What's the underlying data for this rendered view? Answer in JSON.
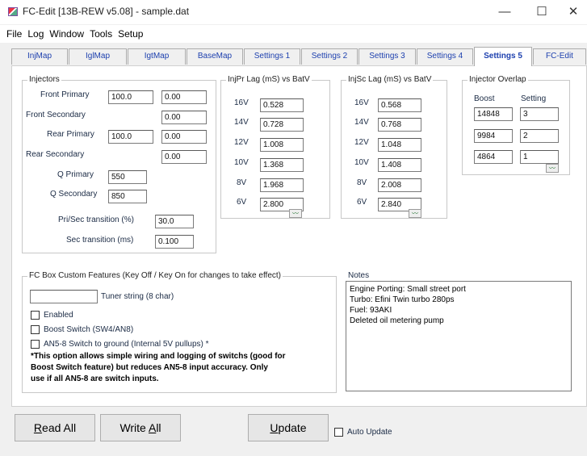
{
  "window": {
    "title": "FC-Edit [13B-REW v5.08] - sample.dat",
    "minimize": "—",
    "maximize": "☐",
    "close": "✕"
  },
  "menu": [
    "File",
    "Log",
    "Window",
    "Tools",
    "Setup"
  ],
  "tabs": [
    "InjMap",
    "IglMap",
    "IgtMap",
    "BaseMap",
    "Settings 1",
    "Settings 2",
    "Settings 3",
    "Settings 4",
    "Settings 5",
    "FC-Edit"
  ],
  "active_tab": "Settings 5",
  "injectors": {
    "title": "Injectors",
    "front_primary": {
      "label": "Front Primary",
      "v1": "100.0",
      "v2": "0.00"
    },
    "front_secondary": {
      "label": "Front Secondary",
      "v2": "0.00"
    },
    "rear_primary": {
      "label": "Rear Primary",
      "v1": "100.0",
      "v2": "0.00"
    },
    "rear_secondary": {
      "label": "Rear Secondary",
      "v2": "0.00"
    },
    "q_primary": {
      "label": "Q Primary",
      "value": "550"
    },
    "q_secondary": {
      "label": "Q Secondary",
      "value": "850"
    },
    "prisec_transition": {
      "label": "Pri/Sec transition (%)",
      "value": "30.0"
    },
    "sec_transition": {
      "label": "Sec transition (ms)",
      "value": "0.100"
    }
  },
  "injpr_lag": {
    "title": "InjPr Lag (mS) vs BatV",
    "rows": [
      {
        "v": "16V",
        "val": "0.528"
      },
      {
        "v": "14V",
        "val": "0.728"
      },
      {
        "v": "12V",
        "val": "1.008"
      },
      {
        "v": "10V",
        "val": "1.368"
      },
      {
        "v": "8V",
        "val": "1.968"
      },
      {
        "v": "6V",
        "val": "2.800"
      }
    ]
  },
  "injsc_lag": {
    "title": "InjSc Lag (mS) vs BatV",
    "rows": [
      {
        "v": "16V",
        "val": "0.568"
      },
      {
        "v": "14V",
        "val": "0.768"
      },
      {
        "v": "12V",
        "val": "1.048"
      },
      {
        "v": "10V",
        "val": "1.408"
      },
      {
        "v": "8V",
        "val": "2.008"
      },
      {
        "v": "6V",
        "val": "2.840"
      }
    ]
  },
  "injector_overlap": {
    "title": "Injector Overlap",
    "col_boost": "Boost",
    "col_setting": "Setting",
    "rows": [
      {
        "boost": "14848",
        "setting": "3"
      },
      {
        "boost": "9984",
        "setting": "2"
      },
      {
        "boost": "4864",
        "setting": "1"
      }
    ]
  },
  "custom_features": {
    "title": "FC Box Custom Features (Key Off / Key On for changes to take effect)",
    "tuner_string_label": "Tuner string (8 char)",
    "tuner_string_value": "",
    "enabled": "Enabled",
    "boost_switch": "Boost Switch (SW4/AN8)",
    "an58": "AN5-8 Switch to ground (Internal 5V pullups) *",
    "note_line1": "*This option allows simple wiring and logging of switchs (good for",
    "note_line2": "Boost Switch feature) but reduces AN5-8 input accuracy. Only",
    "note_line3": "use if all AN5-8 are switch inputs."
  },
  "notes": {
    "title": "Notes",
    "lines": [
      "Engine Porting: Small street port",
      "Turbo: Efini Twin turbo 280ps",
      "Fuel: 93AKI",
      "Deleted oil metering pump"
    ]
  },
  "buttons": {
    "read_all_pre": "R",
    "read_all_post": "ead All",
    "write_all_pre": "Write ",
    "write_all_u": "A",
    "write_all_post": "ll",
    "update_pre": "",
    "update_u": "U",
    "update_post": "pdate",
    "auto_update": "Auto Update"
  },
  "wave_glyph": "〰"
}
